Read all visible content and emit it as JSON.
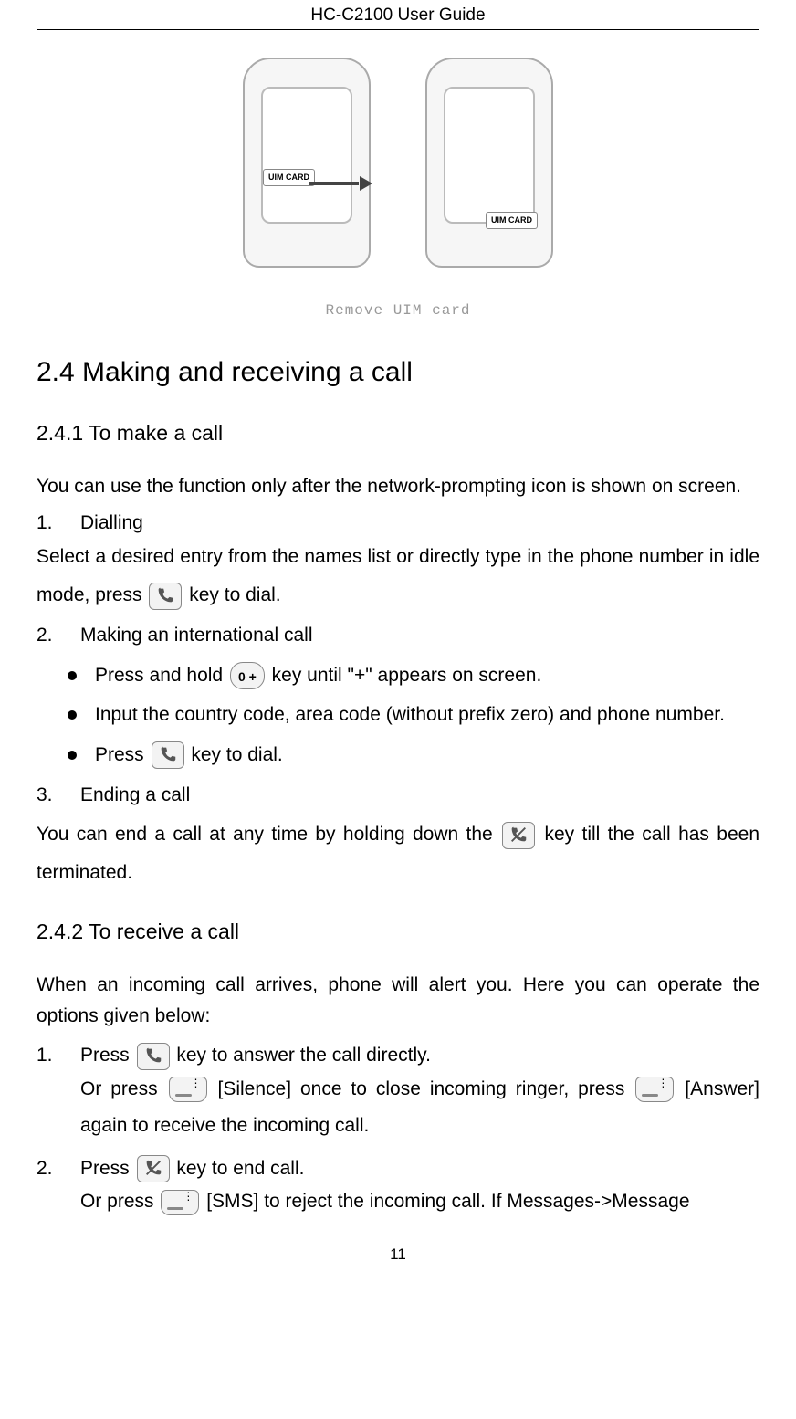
{
  "header": {
    "title": "HC-C2100 User Guide"
  },
  "figure": {
    "caption": "Remove UIM card",
    "uim_label": "UIM\nCARD"
  },
  "section": {
    "heading": "2.4 Making and receiving a call",
    "sub1": {
      "heading": "2.4.1 To make a call",
      "intro": "You can use the function only after the network-prompting icon is shown on screen.",
      "item1_num": "1.",
      "item1_label": "Dialling",
      "item1_text_a": "Select a desired entry from the names list or directly type in the phone number in idle mode, press ",
      "item1_text_b": "key to dial.",
      "item2_num": "2.",
      "item2_label": "Making an international call",
      "b1_a": "Press and hold ",
      "b1_key": "0 +",
      "b1_b": " key until \"+\" appears on screen.",
      "b2": "Input the country code, area code (without prefix zero) and phone number.",
      "b3_a": "Press ",
      "b3_b": "key to dial.",
      "item3_num": "3.",
      "item3_label": "Ending a call",
      "item3_text_a": "You can end a call at any time by holding down the ",
      "item3_text_b": " key till the call has been terminated."
    },
    "sub2": {
      "heading": "2.4.2 To receive a call",
      "intro": "When an incoming call arrives, phone will alert you. Here you can operate the options given below:",
      "item1_num": "1.",
      "item1_a": "Press ",
      "item1_b": "key to answer the call directly.",
      "item1_c": "Or press ",
      "item1_d": " [Silence] once to close incoming ringer, press ",
      "item1_e": " [Answer] again to receive the incoming call.",
      "item2_num": "2.",
      "item2_a": "Press  ",
      "item2_b": "key to end call.",
      "item2_c": "Or press ",
      "item2_d": " [SMS] to reject the incoming call. If Messages->Message"
    }
  },
  "page_number": "11"
}
